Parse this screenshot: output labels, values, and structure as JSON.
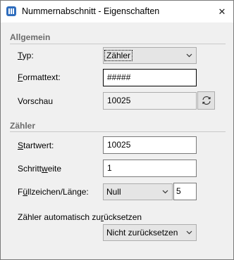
{
  "window": {
    "title": "Nummernabschnitt - Eigenschaften",
    "close_symbol": "✕",
    "app_icon": "document-columns-icon"
  },
  "general": {
    "heading": "Allgemein",
    "type": {
      "label_underlined": "T",
      "label_rest": "yp:",
      "value": "Zähler"
    },
    "format": {
      "label_underlined": "F",
      "label_rest": "ormattext:",
      "value": "#####"
    },
    "preview": {
      "label": "Vorschau",
      "value": "10025",
      "refresh_icon": "refresh-icon"
    }
  },
  "counter": {
    "heading": "Zähler",
    "start": {
      "label_underlined": "S",
      "label_rest": "tartwert:",
      "value": "10025"
    },
    "step": {
      "label_before": "Schritt",
      "label_underlined": "w",
      "label_rest": "eite",
      "value": "1"
    },
    "fill": {
      "label_before": "F",
      "label_underlined": "ü",
      "label_rest": "llzeichen/Länge:",
      "char_value": "Null",
      "length_value": "5"
    },
    "reset": {
      "label_before": "Zähler automatisch zu",
      "label_underlined": "r",
      "label_rest": "ücksetzen",
      "value": "Nicht zurücksetzen"
    }
  },
  "colors": {
    "accent": "#2f6dbd",
    "window_bg": "#f0f0f0",
    "section_text": "#6b6b6b"
  }
}
